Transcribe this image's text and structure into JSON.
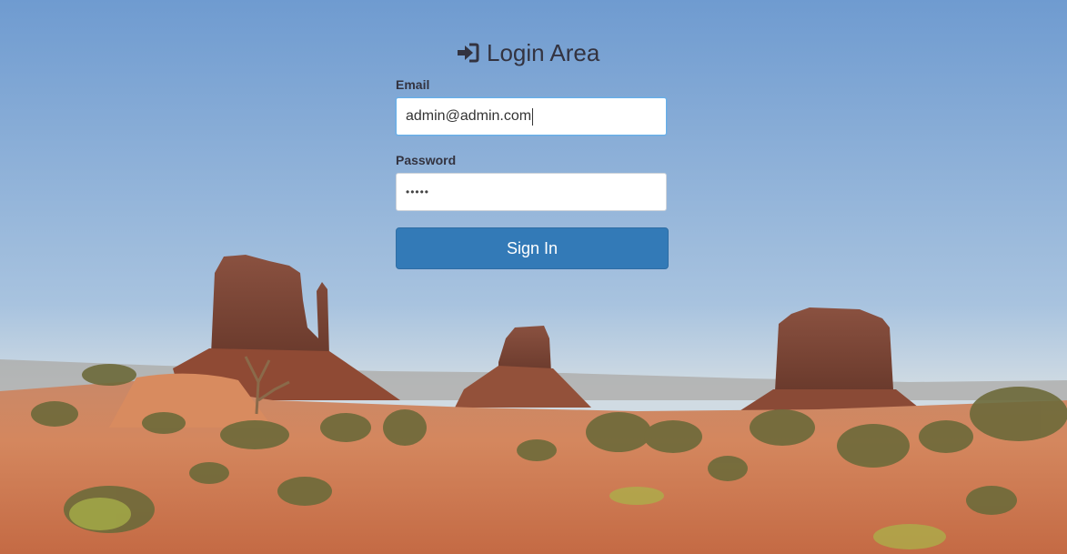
{
  "login": {
    "title": "Login Area",
    "title_icon": "sign-in-icon",
    "email_label": "Email",
    "email_value": "admin@admin.com",
    "password_label": "Password",
    "password_mask": "•••••",
    "submit_label": "Sign In"
  },
  "colors": {
    "primary_button": "#337ab7",
    "heading_text": "#333340",
    "focus_border": "#66afe9"
  },
  "background": {
    "scene": "desert-landscape-image"
  }
}
